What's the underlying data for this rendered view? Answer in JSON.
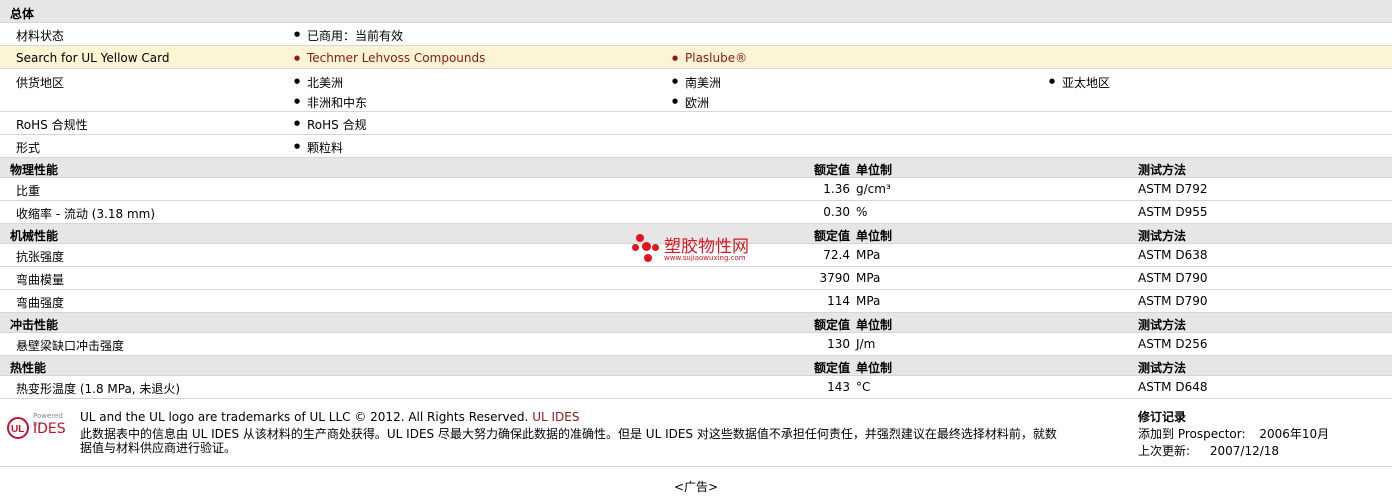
{
  "general": {
    "title": "总体",
    "material_status_label": "材料状态",
    "material_status_value": "已商用：当前有效",
    "yellow_card_label": "Search for UL Yellow Card",
    "yellow_card_links": [
      "Techmer Lehvoss Compounds",
      "Plaslube®"
    ],
    "regions_label": "供货地区",
    "regions": [
      "北美洲",
      "南美洲",
      "亚太地区",
      "非洲和中东",
      "欧洲"
    ],
    "rohs_label": "RoHS 合规性",
    "rohs_value": "RoHS 合规",
    "form_label": "形式",
    "form_value": "颗粒料"
  },
  "headers": {
    "nominal": "额定值",
    "unit": "单位制",
    "method": "测试方法"
  },
  "sections": [
    {
      "title": "物理性能",
      "rows": [
        {
          "label": "比重",
          "value": "1.36",
          "unit": "g/cm³",
          "method": "ASTM D792"
        },
        {
          "label": "收缩率  - 流动  (3.18 mm)",
          "value": "0.30",
          "unit": "%",
          "method": "ASTM D955"
        }
      ]
    },
    {
      "title": "机械性能",
      "rows": [
        {
          "label": "抗张强度",
          "value": "72.4",
          "unit": "MPa",
          "method": "ASTM D638"
        },
        {
          "label": "弯曲模量",
          "value": "3790",
          "unit": "MPa",
          "method": "ASTM D790"
        },
        {
          "label": "弯曲强度",
          "value": "114",
          "unit": "MPa",
          "method": "ASTM D790"
        }
      ]
    },
    {
      "title": "冲击性能",
      "rows": [
        {
          "label": "悬壁梁缺口冲击强度",
          "value": "130",
          "unit": "J/m",
          "method": "ASTM D256"
        }
      ]
    },
    {
      "title": "热性能",
      "rows": [
        {
          "label": "热变形温度  (1.8 MPa, 未退火)",
          "value": "143",
          "unit": "°C",
          "method": "ASTM D648"
        }
      ]
    }
  ],
  "watermark": {
    "text": "塑胶物性网",
    "url": "www.sujiaowuxing.com"
  },
  "footer": {
    "logo_small": "Powered by",
    "logo_text": "IDES",
    "trademark": "UL and the UL logo are trademarks of UL LLC © 2012. All Rights Reserved.",
    "trademark_link": "UL IDES",
    "disclaimer_line1": "此数据表中的信息由  UL IDES 从该材料的生产商处获得。UL IDES 尽最大努力确保此数据的准确性。但是  UL IDES 对这些数据值不承担任何责任，并强烈建议在最终选择材料前，就数",
    "disclaimer_line2": "据值与材料供应商进行验证。",
    "revision_title": "修订记录",
    "added_label": "添加到  Prospector:",
    "added_value": "2006年10月",
    "updated_label": "上次更新:",
    "updated_value": "2007/12/18"
  },
  "ad": "<广告>"
}
